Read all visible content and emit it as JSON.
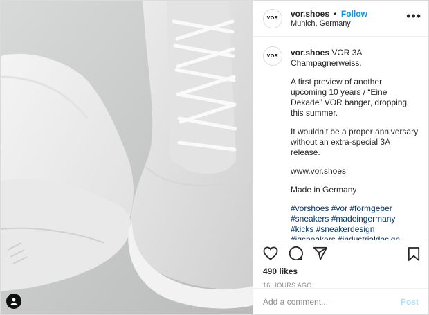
{
  "post": {
    "avatar_text": "VOR",
    "username": "vor.shoes",
    "dot": "•",
    "follow_label": "Follow",
    "location": "Munich, Germany",
    "more_label": "•••"
  },
  "caption": {
    "username": "vor.shoes",
    "title": "VOR 3A Champagnerweiss.",
    "paragraphs": [
      "A first preview of another upcoming 10 years / “Eine Dekade” VOR banger, dropping this summer.",
      "It wouldn’t be a proper anniversary without an extra-special 3A release.",
      "www.vor.shoes",
      "Made in Germany"
    ],
    "hashtags": "#vorshoes #vor #formgeber #sneakers #madeingermany #kicks #sneakerdesign #igsneakers #industrialdesign #footweardesign #munichbrand #sneakerphotoaday #crispwhite #allwhite #sneakpeek #10thanniversary #whomademyshoes"
  },
  "actions": {
    "likes": "490 likes",
    "timestamp": "16 HOURS AGO"
  },
  "comment": {
    "placeholder": "Add a comment...",
    "post_label": "Post"
  },
  "icons": {
    "like": "heart-icon",
    "comment": "comment-icon",
    "share": "share-icon",
    "save": "bookmark-icon",
    "tagged": "user-tag-icon"
  }
}
